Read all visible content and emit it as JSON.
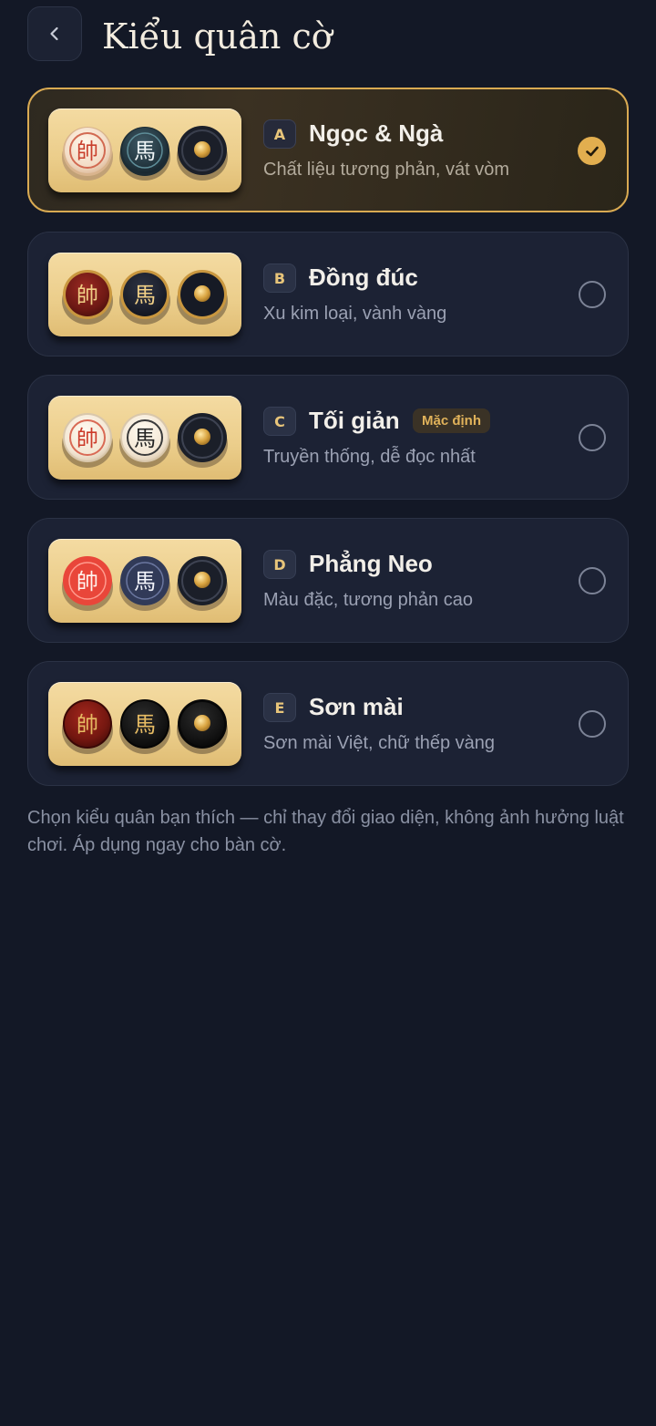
{
  "header": {
    "back_icon": "chevron-left-icon",
    "title": "Kiểu quân cờ"
  },
  "options": [
    {
      "letter": "A",
      "name": "Ngọc & Ngà",
      "description": "Chất liệu tương phản, vát vòm",
      "selected": true,
      "pieces": [
        "帥",
        "馬"
      ],
      "check_icon": "checkmark-icon"
    },
    {
      "letter": "B",
      "name": "Đồng đúc",
      "description": "Xu kim loại, vành vàng",
      "selected": false,
      "pieces": [
        "帥",
        "馬"
      ]
    },
    {
      "letter": "C",
      "name": "Tối giản",
      "badge": "Mặc định",
      "description": "Truyền thống, dễ đọc nhất",
      "selected": false,
      "pieces": [
        "帥",
        "馬"
      ]
    },
    {
      "letter": "D",
      "name": "Phẳng Neo",
      "description": "Màu đặc, tương phản cao",
      "selected": false,
      "pieces": [
        "帥",
        "馬"
      ]
    },
    {
      "letter": "E",
      "name": "Sơn mài",
      "description": "Sơn mài Việt, chữ thếp vàng",
      "selected": false,
      "pieces": [
        "帥",
        "馬"
      ]
    }
  ],
  "footer": {
    "note": "Chọn kiểu quân bạn thích — chỉ thay đổi giao diện, không ảnh hưởng luật chơi. Áp dụng ngay cho bàn cờ."
  },
  "colors": {
    "background": "#131826",
    "card": "#1c2234",
    "accent_gold": "#e2ae4f",
    "tray": "#ebcd8a"
  }
}
